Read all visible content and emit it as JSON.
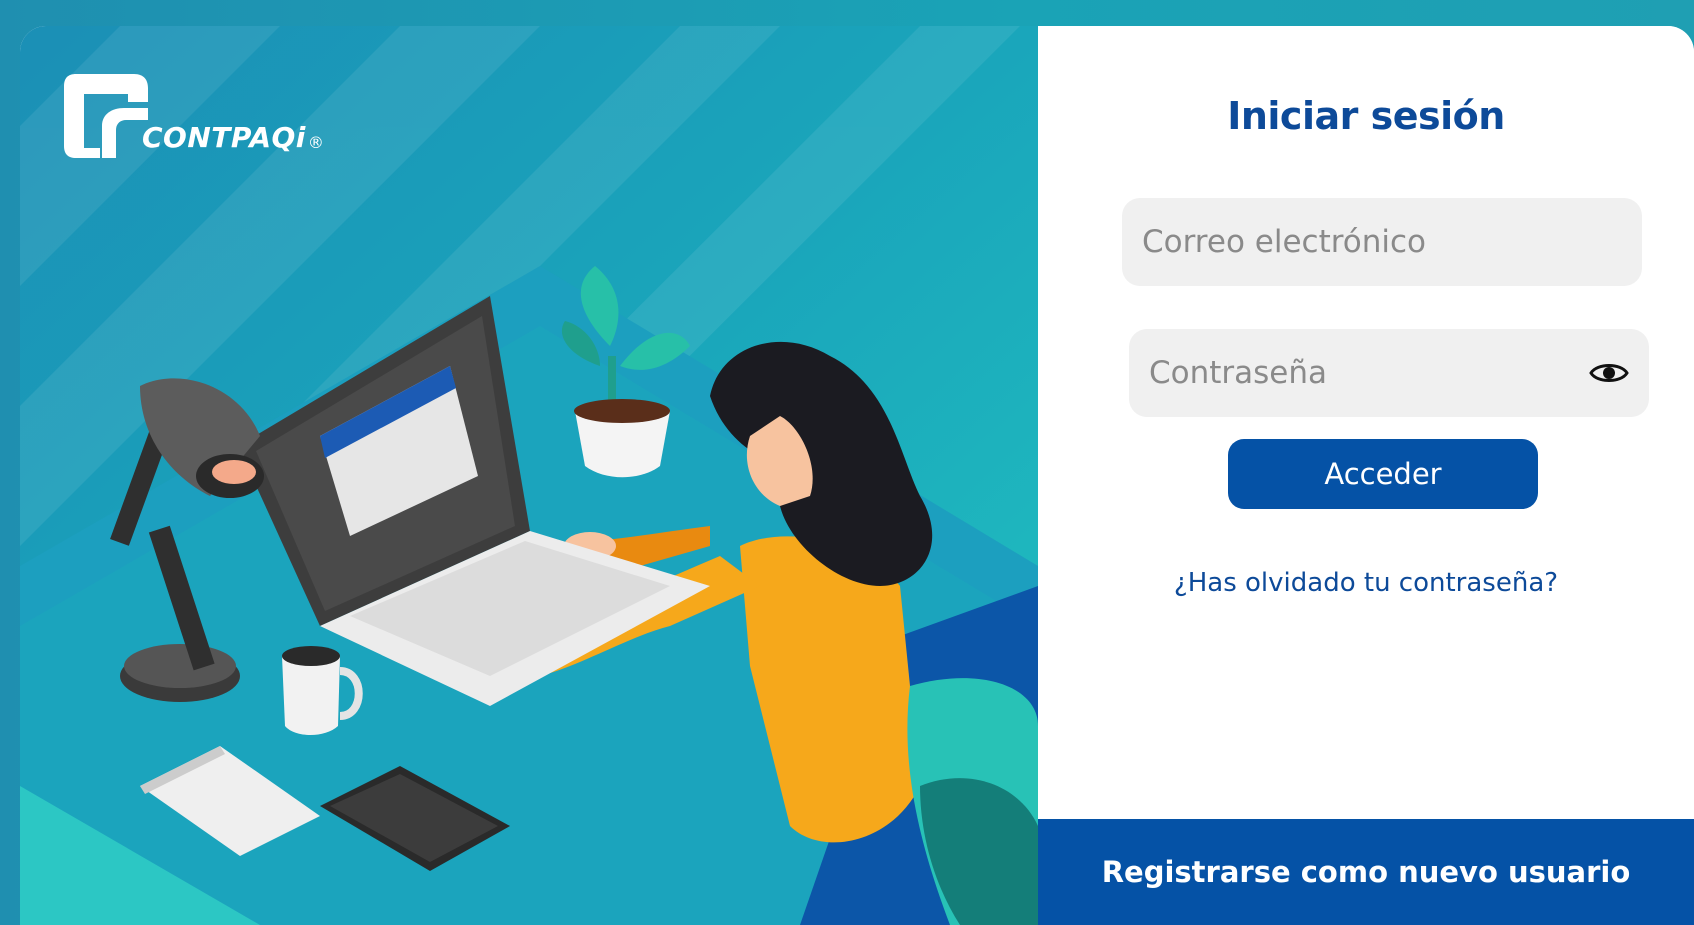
{
  "brand": {
    "logo_text": "CONTPAQi",
    "logo_mark": "®"
  },
  "login": {
    "title": "Iniciar sesión",
    "email_placeholder": "Correo electrónico",
    "password_placeholder": "Contraseña",
    "submit_label": "Acceder",
    "forgot_label": "¿Has olvidado tu contraseña?",
    "register_label": "Registrarse como nuevo usuario"
  },
  "icons": {
    "password_toggle": "eye-icon"
  },
  "colors": {
    "brand_blue": "#0552a6",
    "title_blue": "#0d4a99",
    "field_bg": "#f0f0f0",
    "teal": "#1aa3b6"
  }
}
